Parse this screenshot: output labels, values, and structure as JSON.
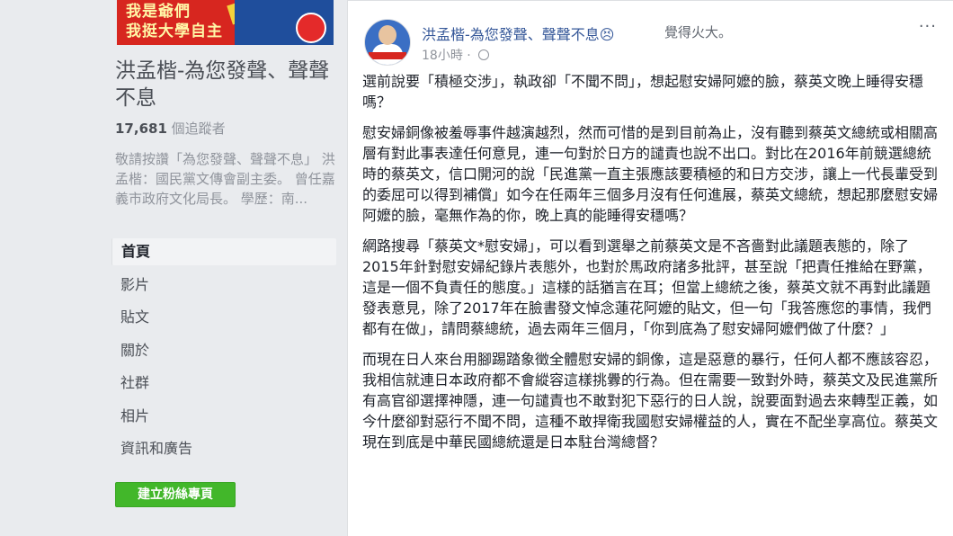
{
  "cover": {
    "text_line1": "我是爺們",
    "text_line2": "我挺大學自主"
  },
  "page": {
    "name": "洪孟楷-為您發聲、聲聲不息",
    "followers_count": "17,681",
    "followers_label": "個追蹤者",
    "about": "敬請按讚「為您發聲、聲聲不息」 洪孟楷：國民黨文傳會副主委。 曾任嘉義市政府文化局長。 學歷：南..."
  },
  "nav": {
    "items": [
      {
        "label": "首頁"
      },
      {
        "label": "影片"
      },
      {
        "label": "貼文"
      },
      {
        "label": "關於"
      },
      {
        "label": "社群"
      },
      {
        "label": "相片"
      },
      {
        "label": "資訊和廣告"
      }
    ],
    "create_button": "建立粉絲專頁"
  },
  "post": {
    "author": "洪孟楷-為您發聲、聲聲不息",
    "feeling_emoji": "😣",
    "feeling": "覺得火大。",
    "timestamp": "18小時 · ",
    "more_label": "···",
    "paragraphs": [
      "選前說要「積極交涉」，執政卻「不聞不問」，想起慰安婦阿嬤的臉，蔡英文晚上睡得安穩嗎？",
      "慰安婦銅像被羞辱事件越演越烈，然而可惜的是到目前為止，沒有聽到蔡英文總統或相關高層有對此事表達任何意見，連一句對於日方的譴責也說不出口。對比在2016年前競選總統時的蔡英文，信口開河的說「民進黨一直主張應該要積極的和日方交涉，讓上一代長輩受到的委屈可以得到補償」如今在任兩年三個多月沒有任何進展，蔡英文總統，想起那麼慰安婦阿嬤的臉，毫無作為的你，晚上真的能睡得安穩嗎？",
      "網路搜尋「蔡英文*慰安婦」，可以看到選舉之前蔡英文是不吝嗇對此議題表態的，除了2015年針對慰安婦紀錄片表態外，也對於馬政府諸多批評，甚至說「把責任推給在野黨，這是一個不負責任的態度。」這樣的話猶言在耳；但當上總統之後，蔡英文就不再對此議題發表意見，除了2017年在臉書發文悼念蓮花阿嬤的貼文，但一句「我答應您的事情，我們都有在做」，請問蔡總統，過去兩年三個月，「你到底為了慰安婦阿嬤們做了什麼？」",
      "而現在日人來台用腳踢踏象徵全體慰安婦的銅像，這是惡意的暴行，任何人都不應該容忍，我相信就連日本政府都不會縱容這樣挑釁的行為。但在需要一致對外時，蔡英文及民進黨所有高官卻選擇神隱，連一句譴責也不敢對犯下惡行的日人說，說要面對過去來轉型正義，如今什麼卻對惡行不聞不問，這種不敢捍衛我國慰安婦權益的人，實在不配坐享高位。蔡英文現在到底是中華民國總統還是日本駐台灣總督？"
    ]
  },
  "colors": {
    "link": "#365899",
    "page_bg": "#e9ebee",
    "button_green": "#42b72a"
  }
}
